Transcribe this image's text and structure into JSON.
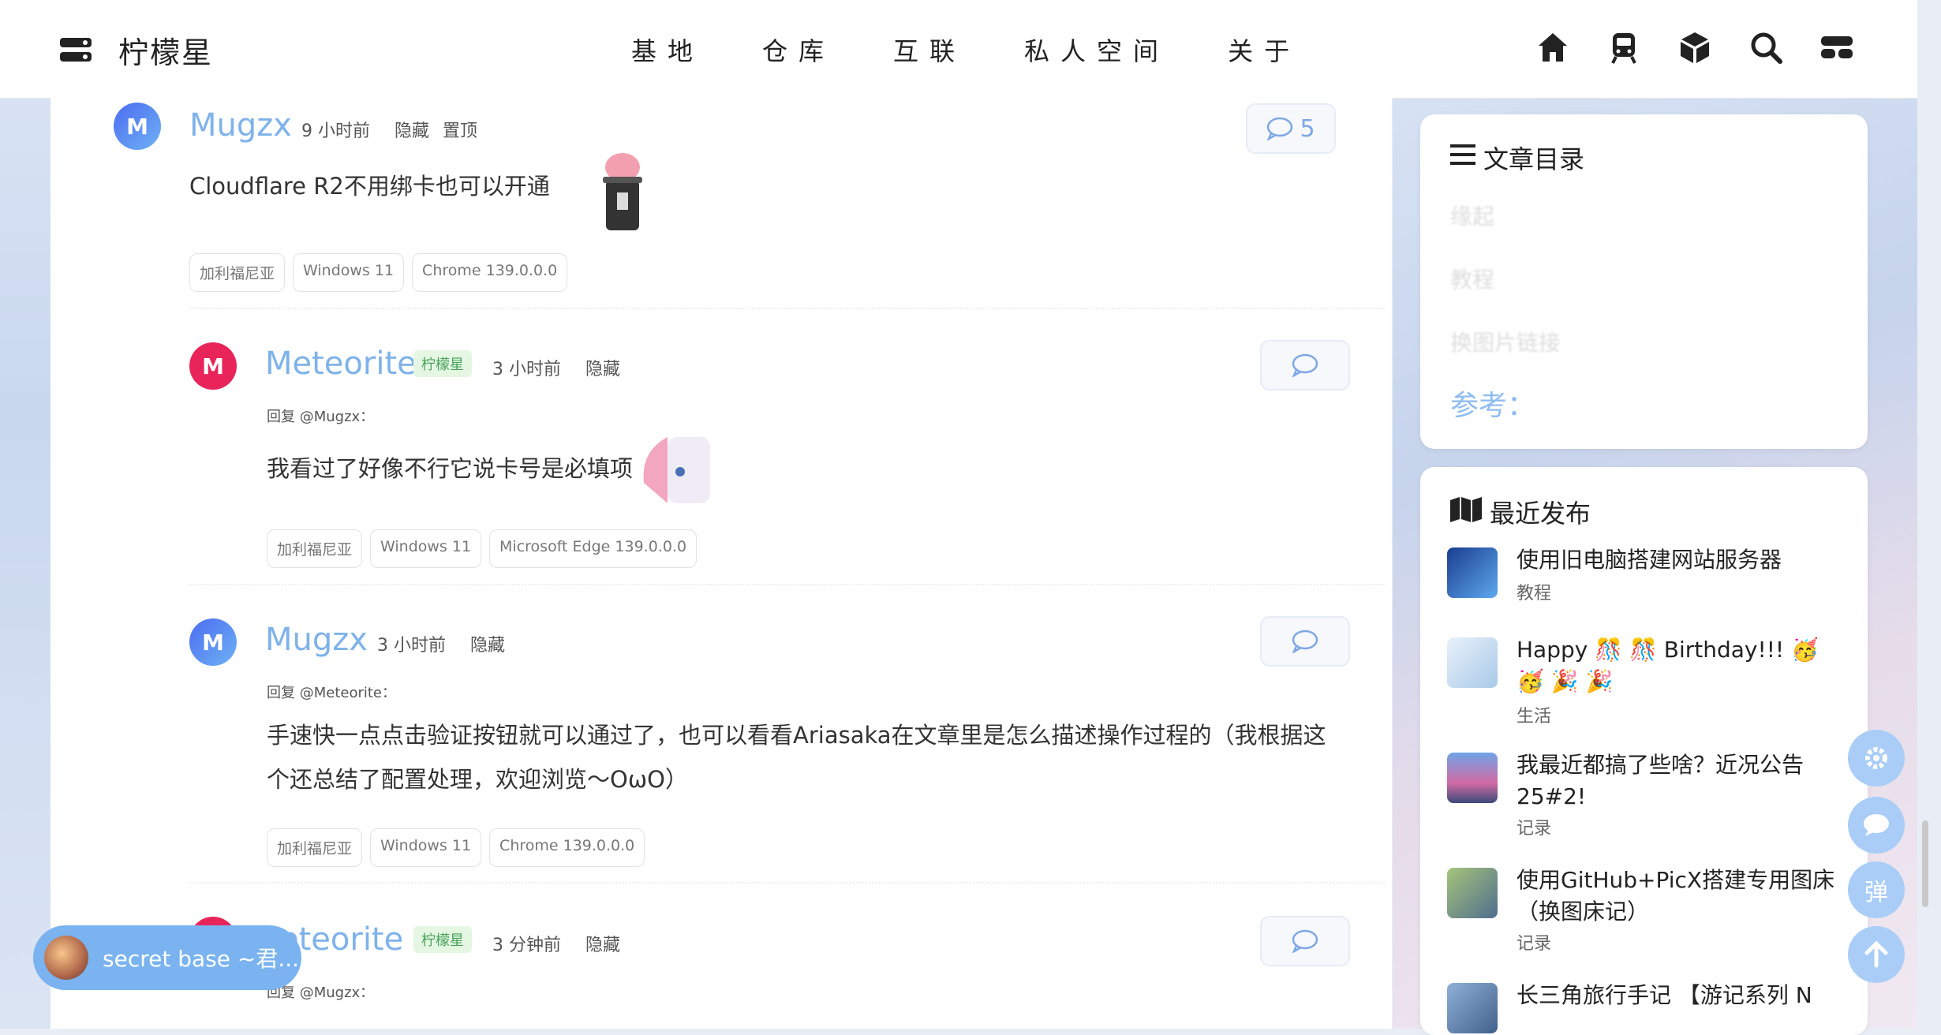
{
  "header": {
    "site_title": "柠檬星",
    "nav": [
      "基地",
      "仓库",
      "互联",
      "私人空间",
      "关于"
    ],
    "icons": [
      "home-icon",
      "train-icon",
      "cube-icon",
      "search-icon",
      "toggle-icon"
    ]
  },
  "comments": [
    {
      "author": "Mugzx",
      "avatar_letter": "M",
      "time": "9 小时前",
      "actions": [
        "隐藏",
        "置顶"
      ],
      "reply_count": "5",
      "content": "Cloudflare R2不用绑卡也可以开通",
      "tags": [
        "加利福尼亚",
        "Windows 11",
        "Chrome 139.0.0.0"
      ]
    },
    {
      "author": "Meteorite",
      "avatar_letter": "M",
      "badge": "柠檬星",
      "time": "3 小时前",
      "actions": [
        "隐藏"
      ],
      "reply_to": "回复 @Mugzx：",
      "content": "我看过了好像不行它说卡号是必填项",
      "tags": [
        "加利福尼亚",
        "Windows 11",
        "Microsoft Edge 139.0.0.0"
      ]
    },
    {
      "author": "Mugzx",
      "avatar_letter": "M",
      "time": "3 小时前",
      "actions": [
        "隐藏"
      ],
      "reply_to": "回复 @Meteorite：",
      "content_lines": [
        "手速快一点点击验证按钮就可以通过了，也可以看看Ariasaka在文章里是怎么描述操作过程的（我根据这",
        "个还总结了配置处理，欢迎浏览～OωO）"
      ],
      "tags": [
        "加利福尼亚",
        "Windows 11",
        "Chrome 139.0.0.0"
      ]
    },
    {
      "author": "eteorite",
      "avatar_letter": "M",
      "badge": "柠檬星",
      "time": "3 分钟前",
      "actions": [
        "隐藏"
      ],
      "reply_to": "回复 @Mugzx："
    }
  ],
  "sidebar": {
    "toc": {
      "title": "文章目录",
      "items": [
        "缘起",
        "教程",
        "换图片链接"
      ],
      "active": "参考："
    },
    "recent": {
      "title": "最近发布",
      "posts": [
        {
          "title": "使用旧电脑搭建网站服务器",
          "category": "教程",
          "color": "#2b5fb0"
        },
        {
          "title": "Happy 🎊 🎊 Birthday!!! 🥳 🥳 🎉 🎉",
          "category": "生活",
          "color": "#b7d8ee"
        },
        {
          "title": "我最近都搞了些啥？近况公告25#2!",
          "category": "记录",
          "color": "#c86aa0"
        },
        {
          "title": "使用GitHub+PicX搭建专用图床（换图床记）",
          "category": "记录",
          "color": "#7a9a5c"
        },
        {
          "title": "长三角旅行手记 【游记系列 N",
          "category": "",
          "color": "#6d8bb5"
        }
      ]
    }
  },
  "floating": {
    "buttons": [
      "settings-icon",
      "chat-icon",
      "弹",
      "arrow-up-icon"
    ]
  },
  "music": {
    "title": "secret base ~君..."
  }
}
